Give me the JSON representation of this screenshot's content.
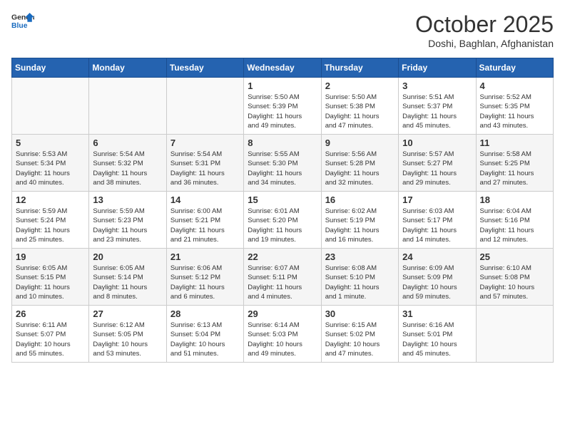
{
  "header": {
    "logo_line1": "General",
    "logo_line2": "Blue",
    "title": "October 2025",
    "subtitle": "Doshi, Baghlan, Afghanistan"
  },
  "weekdays": [
    "Sunday",
    "Monday",
    "Tuesday",
    "Wednesday",
    "Thursday",
    "Friday",
    "Saturday"
  ],
  "weeks": [
    [
      {
        "day": "",
        "info": ""
      },
      {
        "day": "",
        "info": ""
      },
      {
        "day": "",
        "info": ""
      },
      {
        "day": "1",
        "info": "Sunrise: 5:50 AM\nSunset: 5:39 PM\nDaylight: 11 hours\nand 49 minutes."
      },
      {
        "day": "2",
        "info": "Sunrise: 5:50 AM\nSunset: 5:38 PM\nDaylight: 11 hours\nand 47 minutes."
      },
      {
        "day": "3",
        "info": "Sunrise: 5:51 AM\nSunset: 5:37 PM\nDaylight: 11 hours\nand 45 minutes."
      },
      {
        "day": "4",
        "info": "Sunrise: 5:52 AM\nSunset: 5:35 PM\nDaylight: 11 hours\nand 43 minutes."
      }
    ],
    [
      {
        "day": "5",
        "info": "Sunrise: 5:53 AM\nSunset: 5:34 PM\nDaylight: 11 hours\nand 40 minutes."
      },
      {
        "day": "6",
        "info": "Sunrise: 5:54 AM\nSunset: 5:32 PM\nDaylight: 11 hours\nand 38 minutes."
      },
      {
        "day": "7",
        "info": "Sunrise: 5:54 AM\nSunset: 5:31 PM\nDaylight: 11 hours\nand 36 minutes."
      },
      {
        "day": "8",
        "info": "Sunrise: 5:55 AM\nSunset: 5:30 PM\nDaylight: 11 hours\nand 34 minutes."
      },
      {
        "day": "9",
        "info": "Sunrise: 5:56 AM\nSunset: 5:28 PM\nDaylight: 11 hours\nand 32 minutes."
      },
      {
        "day": "10",
        "info": "Sunrise: 5:57 AM\nSunset: 5:27 PM\nDaylight: 11 hours\nand 29 minutes."
      },
      {
        "day": "11",
        "info": "Sunrise: 5:58 AM\nSunset: 5:25 PM\nDaylight: 11 hours\nand 27 minutes."
      }
    ],
    [
      {
        "day": "12",
        "info": "Sunrise: 5:59 AM\nSunset: 5:24 PM\nDaylight: 11 hours\nand 25 minutes."
      },
      {
        "day": "13",
        "info": "Sunrise: 5:59 AM\nSunset: 5:23 PM\nDaylight: 11 hours\nand 23 minutes."
      },
      {
        "day": "14",
        "info": "Sunrise: 6:00 AM\nSunset: 5:21 PM\nDaylight: 11 hours\nand 21 minutes."
      },
      {
        "day": "15",
        "info": "Sunrise: 6:01 AM\nSunset: 5:20 PM\nDaylight: 11 hours\nand 19 minutes."
      },
      {
        "day": "16",
        "info": "Sunrise: 6:02 AM\nSunset: 5:19 PM\nDaylight: 11 hours\nand 16 minutes."
      },
      {
        "day": "17",
        "info": "Sunrise: 6:03 AM\nSunset: 5:17 PM\nDaylight: 11 hours\nand 14 minutes."
      },
      {
        "day": "18",
        "info": "Sunrise: 6:04 AM\nSunset: 5:16 PM\nDaylight: 11 hours\nand 12 minutes."
      }
    ],
    [
      {
        "day": "19",
        "info": "Sunrise: 6:05 AM\nSunset: 5:15 PM\nDaylight: 11 hours\nand 10 minutes."
      },
      {
        "day": "20",
        "info": "Sunrise: 6:05 AM\nSunset: 5:14 PM\nDaylight: 11 hours\nand 8 minutes."
      },
      {
        "day": "21",
        "info": "Sunrise: 6:06 AM\nSunset: 5:12 PM\nDaylight: 11 hours\nand 6 minutes."
      },
      {
        "day": "22",
        "info": "Sunrise: 6:07 AM\nSunset: 5:11 PM\nDaylight: 11 hours\nand 4 minutes."
      },
      {
        "day": "23",
        "info": "Sunrise: 6:08 AM\nSunset: 5:10 PM\nDaylight: 11 hours\nand 1 minute."
      },
      {
        "day": "24",
        "info": "Sunrise: 6:09 AM\nSunset: 5:09 PM\nDaylight: 10 hours\nand 59 minutes."
      },
      {
        "day": "25",
        "info": "Sunrise: 6:10 AM\nSunset: 5:08 PM\nDaylight: 10 hours\nand 57 minutes."
      }
    ],
    [
      {
        "day": "26",
        "info": "Sunrise: 6:11 AM\nSunset: 5:07 PM\nDaylight: 10 hours\nand 55 minutes."
      },
      {
        "day": "27",
        "info": "Sunrise: 6:12 AM\nSunset: 5:05 PM\nDaylight: 10 hours\nand 53 minutes."
      },
      {
        "day": "28",
        "info": "Sunrise: 6:13 AM\nSunset: 5:04 PM\nDaylight: 10 hours\nand 51 minutes."
      },
      {
        "day": "29",
        "info": "Sunrise: 6:14 AM\nSunset: 5:03 PM\nDaylight: 10 hours\nand 49 minutes."
      },
      {
        "day": "30",
        "info": "Sunrise: 6:15 AM\nSunset: 5:02 PM\nDaylight: 10 hours\nand 47 minutes."
      },
      {
        "day": "31",
        "info": "Sunrise: 6:16 AM\nSunset: 5:01 PM\nDaylight: 10 hours\nand 45 minutes."
      },
      {
        "day": "",
        "info": ""
      }
    ]
  ]
}
